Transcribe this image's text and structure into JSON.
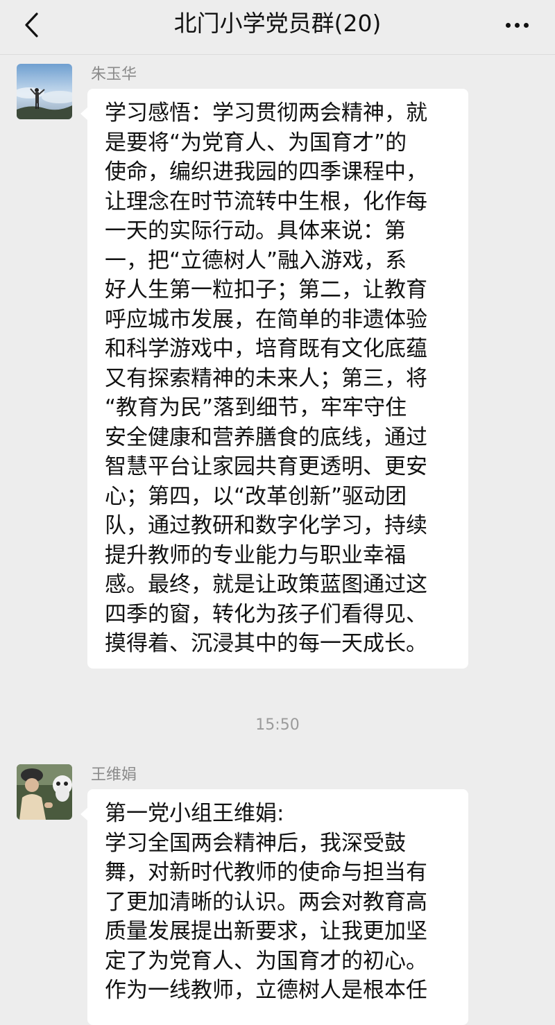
{
  "header": {
    "title": "北门小学党员群(20)",
    "back_icon": "chevron-left-icon",
    "more_icon": "ellipsis-icon"
  },
  "messages": [
    {
      "sender": "朱玉华",
      "text": "学习感悟：学习贯彻两会精神，就\n是要将“为党育人、为国育才”的\n使命，编织进我园的四季课程中，\n让理念在时节流转中生根，化作每\n一天的实际行动。具体来说：第\n一，把“立德树人”融入游戏，系\n好人生第一粒扣子；第二，让教育\n呼应城市发展，在简单的非遗体验\n和科学游戏中，培育既有文化底蕴\n又有探索精神的未来人；第三，将\n“教育为民”落到细节，牢牢守住\n安全健康和营养膳食的底线，通过\n智慧平台让家园共育更透明、更安\n心；第四，以“改革创新”驱动团\n队，通过教研和数字化学习，持续\n提升教师的专业能力与职业幸福\n感。最终，就是让政策蓝图通过这\n四季的窗，转化为孩子们看得见、\n摸得着、沉浸其中的每一天成长。"
    },
    {
      "sender": "王维娟",
      "text": "第一党小组王维娟:\n学习全国两会精神后，我深受鼓\n舞，对新时代教师的使命与担当有\n了更加清晰的认识。两会对教育高\n质量发展提出新要求，让我更加坚\n定了为党育人、为国育才的初心。\n作为一线教师，立德树人是根本任"
    }
  ],
  "timestamp": "15:50"
}
